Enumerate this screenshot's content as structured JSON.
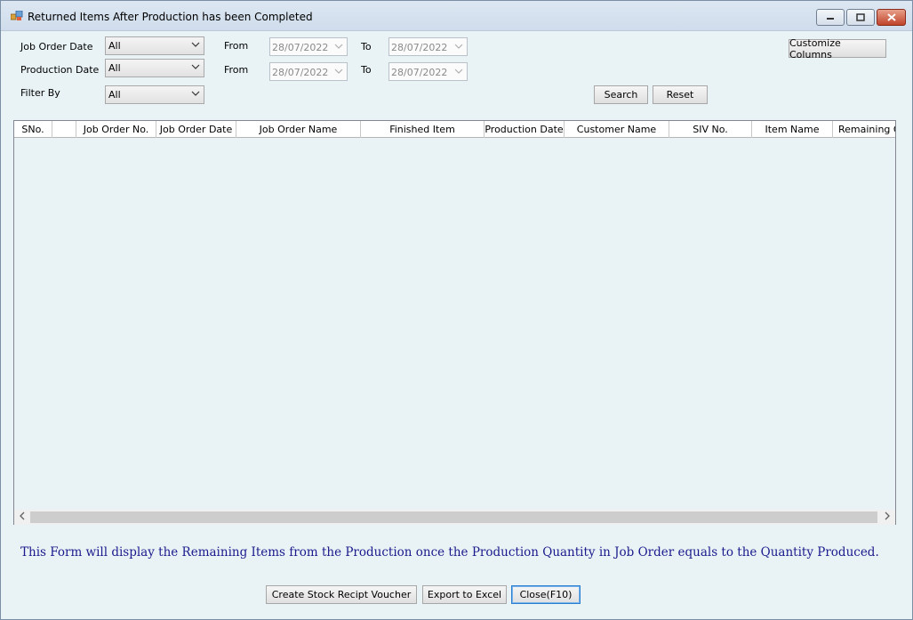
{
  "window": {
    "title": "Returned Items After Production has been Completed"
  },
  "filters": {
    "job_order_date_label": "Job Order Date",
    "job_order_date_value": "All",
    "production_date_label": "Production Date",
    "production_date_value": "All",
    "filter_by_label": "Filter By",
    "filter_by_value": "All",
    "from_label": "From",
    "to_label": "To",
    "job_order_from": "28/07/2022",
    "job_order_to": "28/07/2022",
    "production_from": "28/07/2022",
    "production_to": "28/07/2022"
  },
  "buttons": {
    "customize_columns": "Customize Columns",
    "search": "Search",
    "reset": "Reset",
    "create_voucher": "Create Stock Recipt Voucher",
    "export_excel": "Export to Excel",
    "close": "Close(F10)"
  },
  "grid": {
    "columns": [
      "SNo.",
      "",
      "Job Order No.",
      "Job Order Date",
      "Job Order Name",
      "Finished Item",
      "Production Date",
      "Customer Name",
      "SIV No.",
      "Item Name",
      "Remaining Q"
    ],
    "rows": []
  },
  "info_text": "This Form will display the Remaining Items from the Production once the Production Quantity in Job Order equals to the Quantity Produced."
}
